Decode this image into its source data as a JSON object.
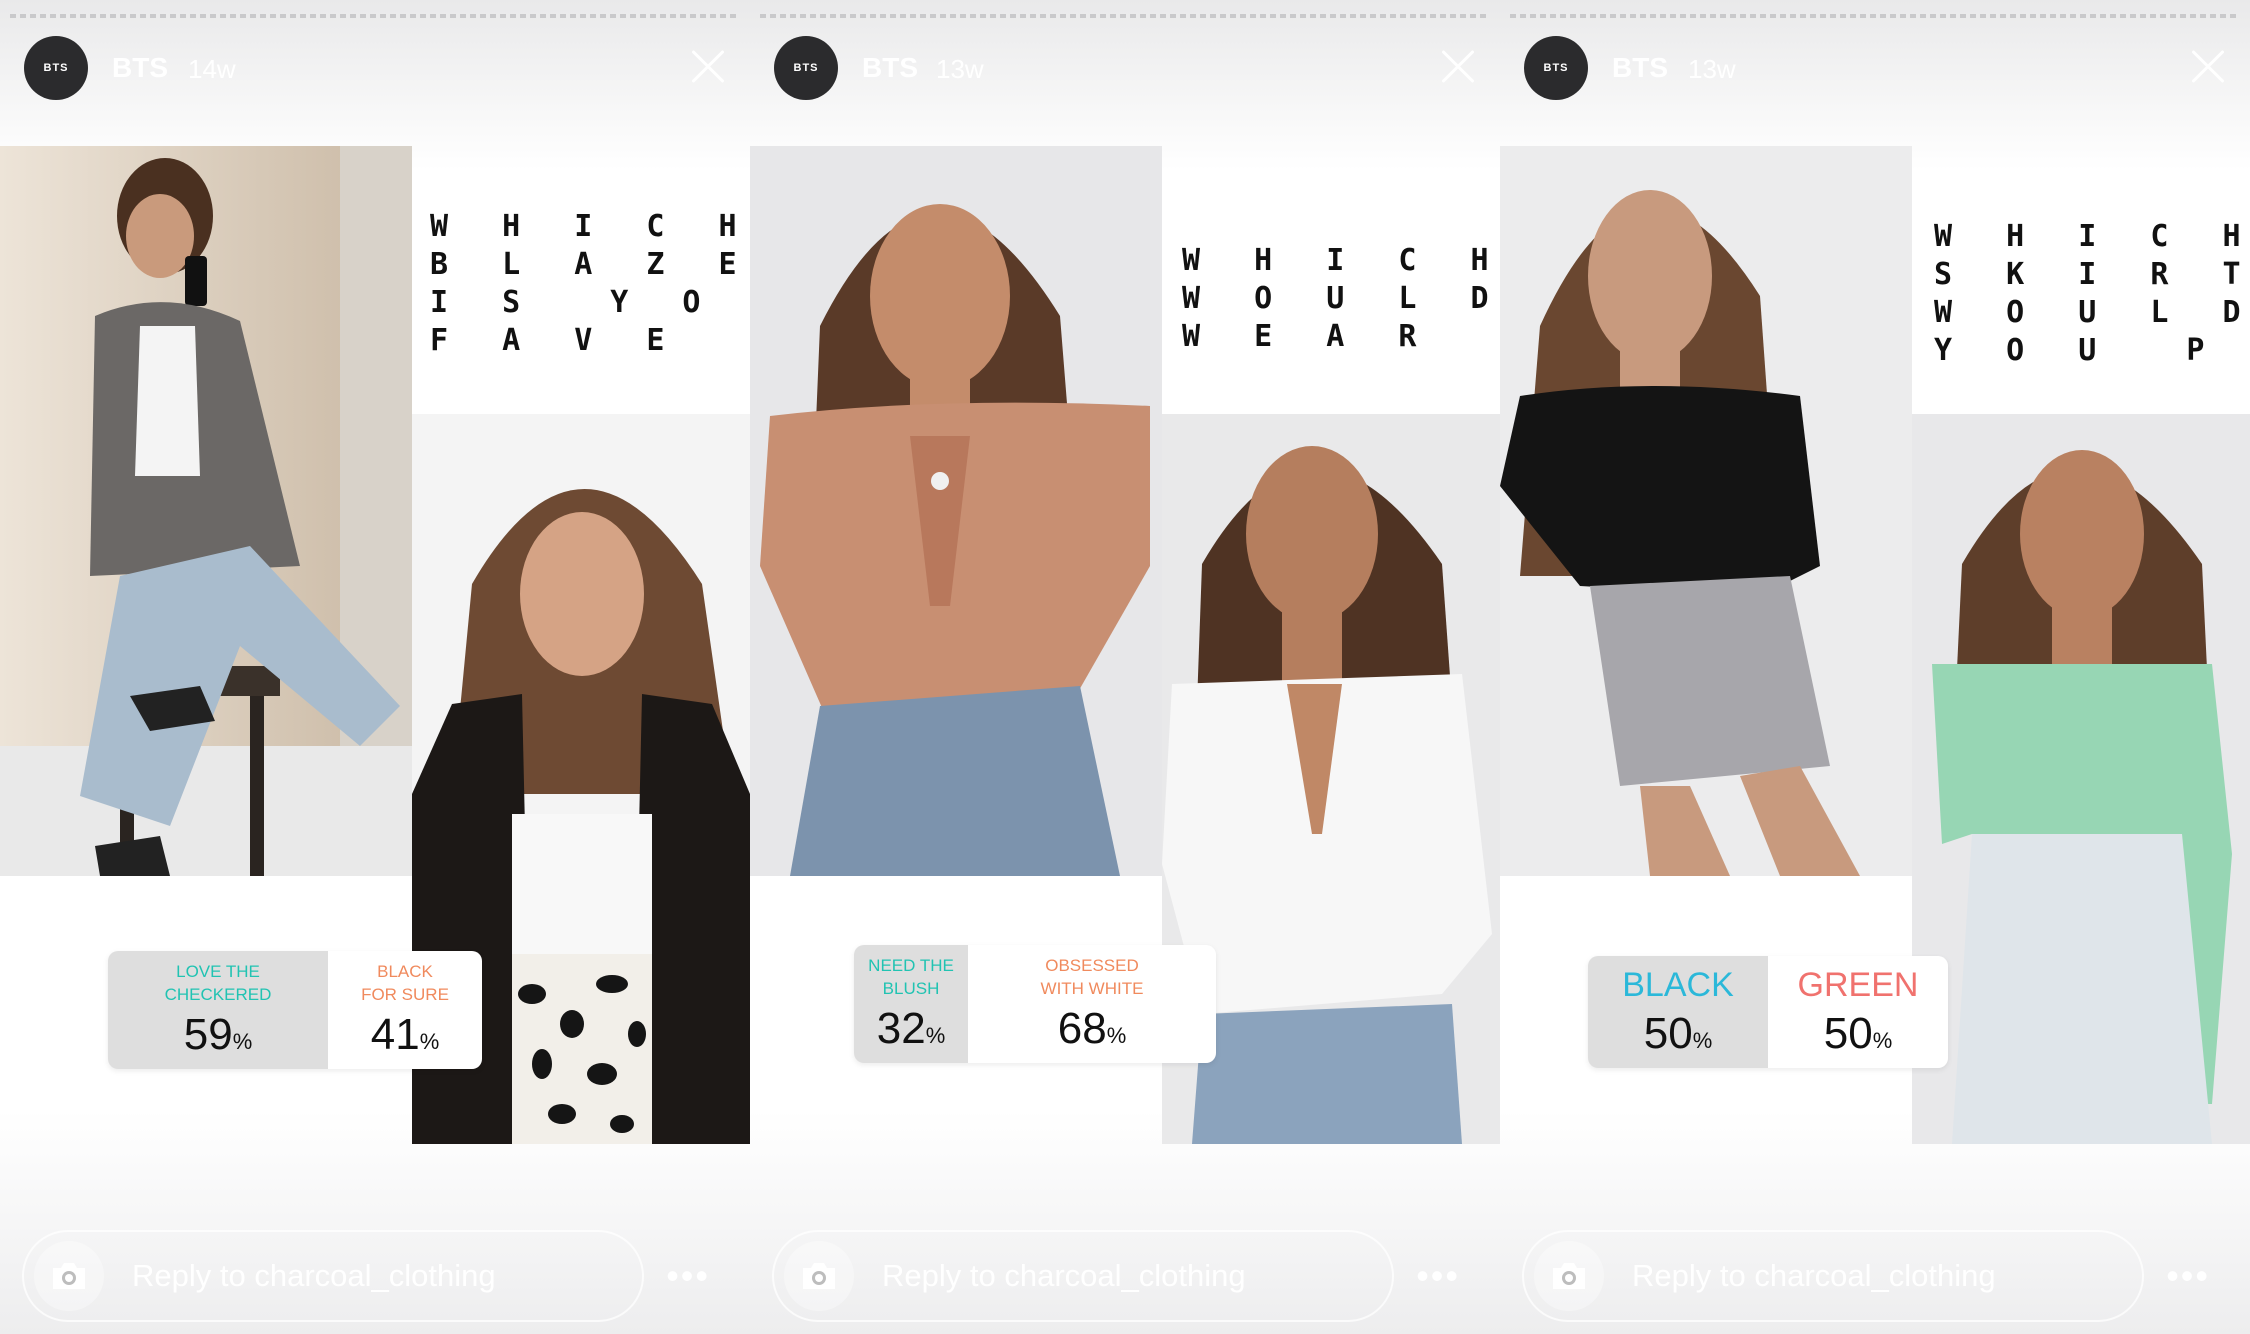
{
  "account": {
    "username": "BTS",
    "avatar_text": "BTS"
  },
  "reply_placeholder": "Reply to charcoal_clothing",
  "more_label": "•••",
  "stories": [
    {
      "age": "14w",
      "question": "W H I C H\nB L A Z E R\nI S  Y O U R\nF A V E  ?",
      "poll": [
        {
          "label": "LOVE THE\nCHECKERED",
          "percent": "59",
          "color": "#21c3b2",
          "share": 0.59
        },
        {
          "label": "BLACK\nFOR SURE",
          "percent": "41",
          "color": "#f08a5d",
          "share": 0.41
        }
      ]
    },
    {
      "age": "13w",
      "question": "W H I C H  T O P\nW O U L D  Y O U\nW E A R  ?",
      "poll": [
        {
          "label": "NEED THE\nBLUSH",
          "percent": "32",
          "color": "#21c3b2",
          "share": 0.32
        },
        {
          "label": "OBSESSED\nWITH WHITE",
          "percent": "68",
          "color": "#f08a5d",
          "share": 0.68
        }
      ]
    },
    {
      "age": "13w",
      "question": "W H I C H\nS K I R T\nW O U L D\nY O U  P I C K?",
      "poll": [
        {
          "label": "BLACK",
          "percent": "50",
          "color": "#2bb8d9",
          "share": 0.5
        },
        {
          "label": "GREEN",
          "percent": "50",
          "color": "#f0726e",
          "share": 0.5
        }
      ]
    }
  ],
  "percent_sign": "%"
}
